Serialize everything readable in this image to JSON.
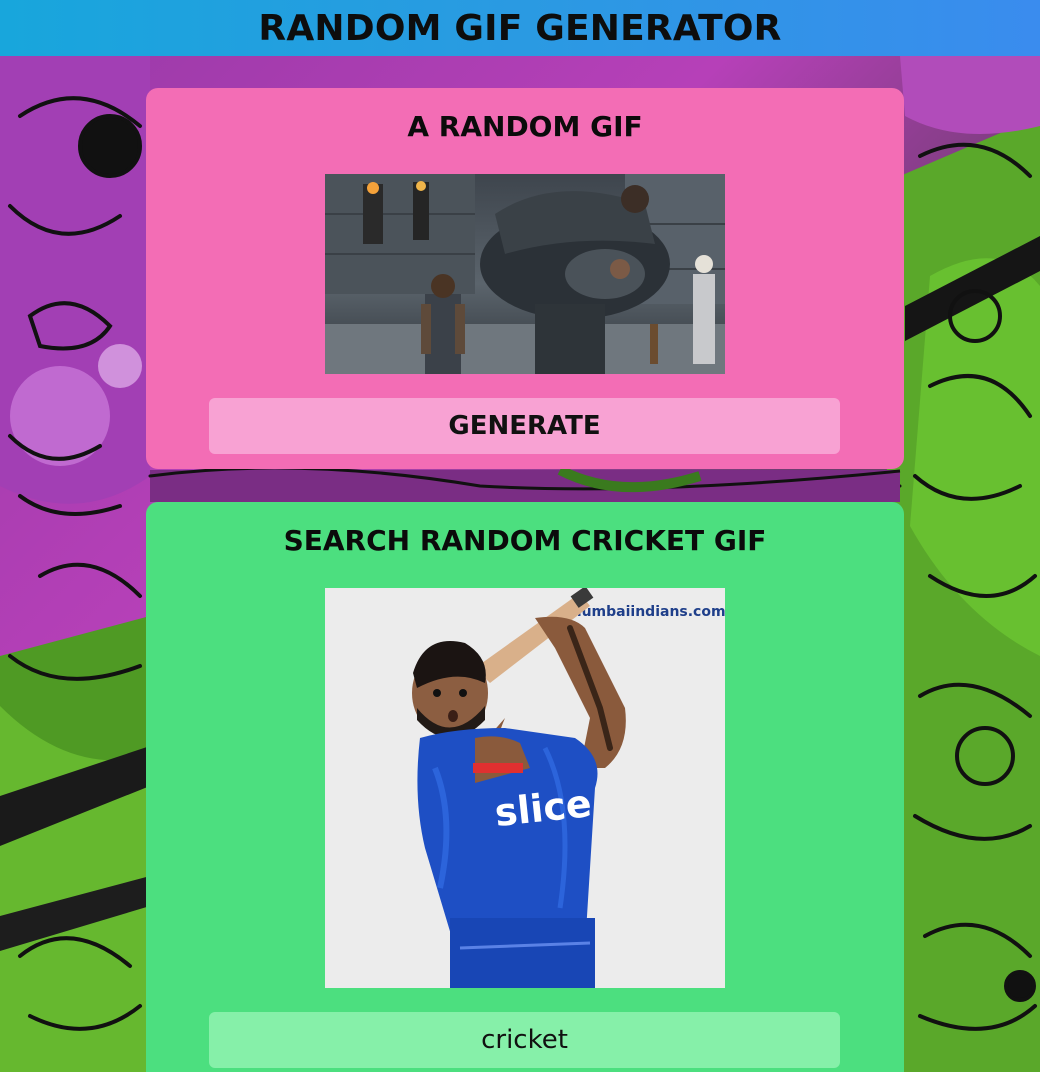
{
  "header": {
    "title": "RANDOM GIF GENERATOR"
  },
  "random_card": {
    "title": "A RANDOM GIF",
    "button_label": "GENERATE"
  },
  "search_card": {
    "title": "SEARCH RANDOM CRICKET GIF",
    "gif_watermark": "mumbaiindians.com",
    "jersey_text": "slice",
    "search_value": "cricket"
  },
  "colors": {
    "header_gradient_start": "#18a6dc",
    "header_gradient_end": "#3a8cee",
    "random_card_bg": "#f36db5",
    "random_button_bg": "#f8a2d3",
    "search_card_bg": "#4cdf7f",
    "search_input_bg": "#86f0a9"
  }
}
